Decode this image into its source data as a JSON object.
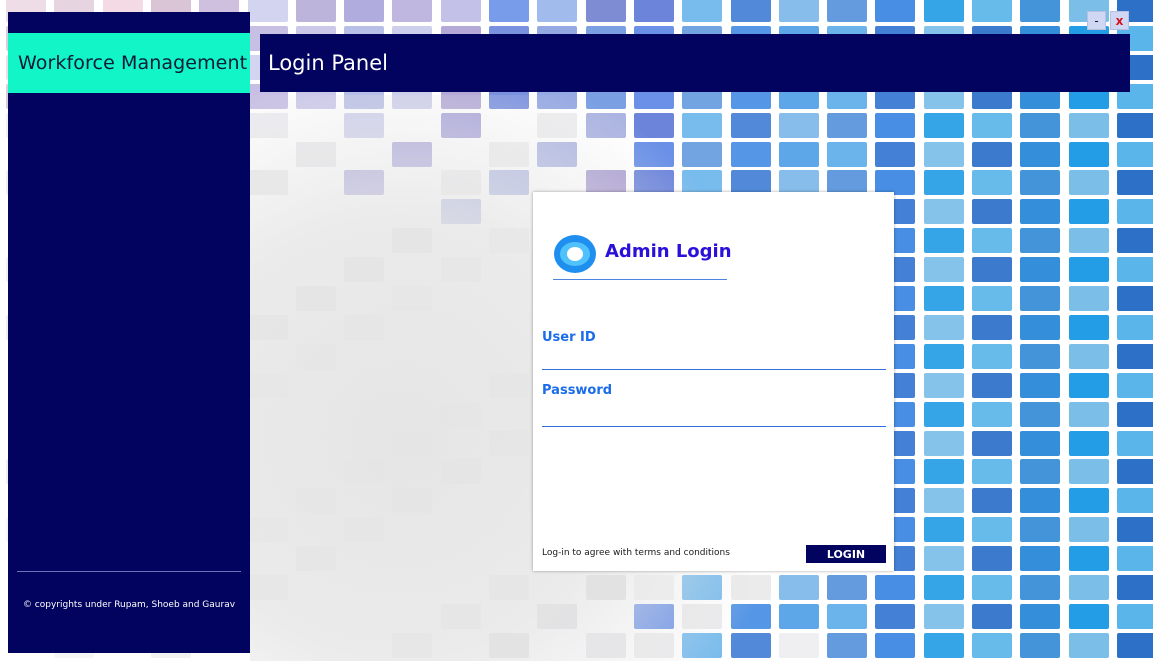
{
  "app": {
    "brand_title": "Workforce Management",
    "copyright": "© copyrights under Rupam, Shoeb and Gaurav"
  },
  "header": {
    "title": "Login Panel"
  },
  "window_controls": {
    "minimize_label": "-",
    "close_label": "x"
  },
  "login_card": {
    "logo_icon": "eye-circle-icon",
    "title": "Admin Login",
    "user_id_label": "User ID",
    "user_id_value": "",
    "password_label": "Password",
    "password_value": "",
    "terms_text": "Log-in to agree with terms and conditions",
    "login_button_label": "LOGIN"
  },
  "colors": {
    "navy": "#02025f",
    "brand_teal": "#12f5c6",
    "accent_blue": "#1a6ce8",
    "title_blue": "#2a10d8"
  }
}
